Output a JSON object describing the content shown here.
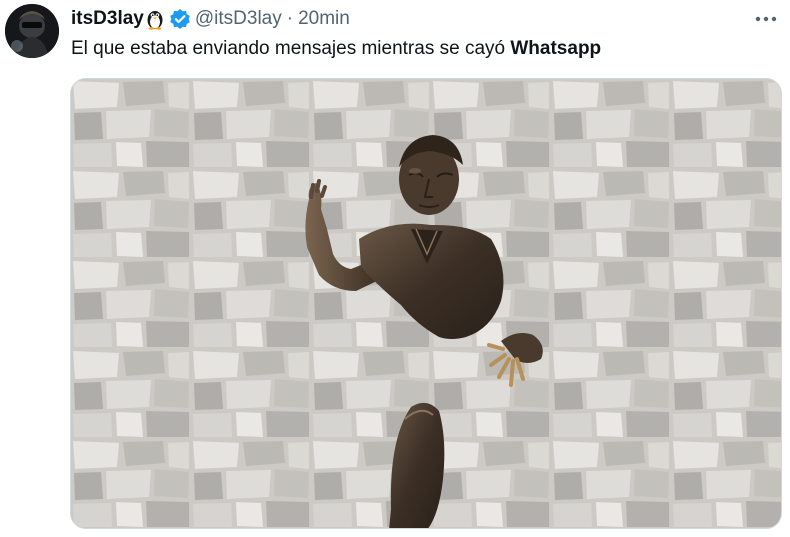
{
  "tweet": {
    "display_name": "itsD3lay",
    "handle": "@itsD3lay",
    "separator": "·",
    "timestamp": "20min",
    "text_main": "El que estaba enviando mensajes mientras se cayó ",
    "text_bold": "Whatsapp",
    "icons": {
      "name_emoji": "penguin-icon",
      "verified": "verified-badge-icon",
      "more": "more-options-icon"
    },
    "media_description_alt": ""
  },
  "colors": {
    "text_primary": "#0f1419",
    "text_secondary": "#536471",
    "verified_blue": "#1d9bf0",
    "media_border": "#cfd9de"
  }
}
